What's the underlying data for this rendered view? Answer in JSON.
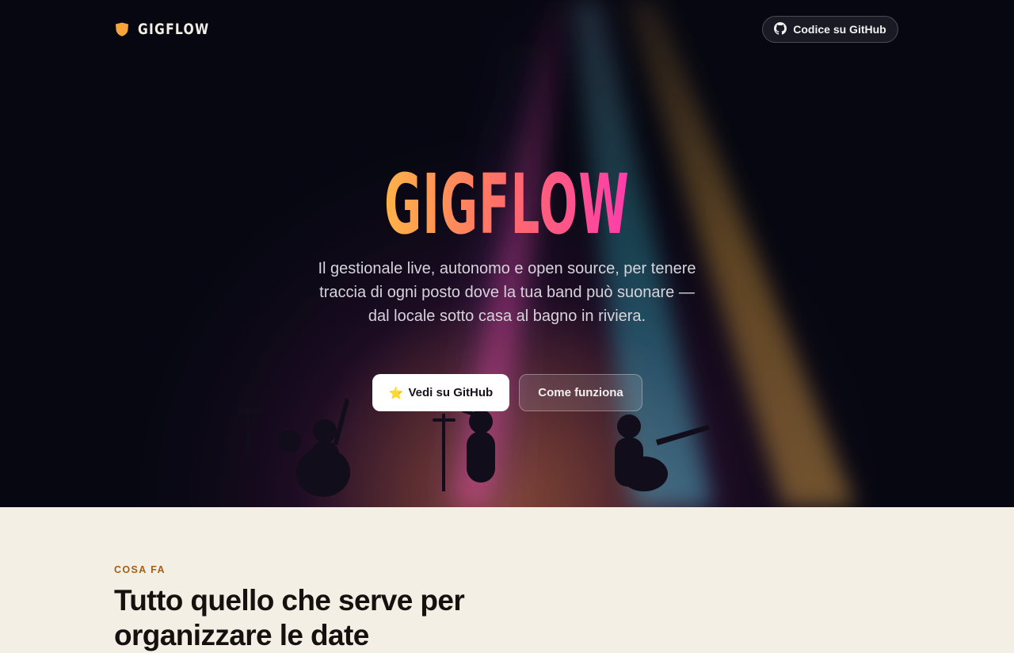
{
  "nav": {
    "logo_text": "GIGFLOW",
    "github_label": "Codice su GitHub"
  },
  "hero": {
    "title": "GIGFLOW",
    "subtitle": "Il gestionale live, autonomo e open source, per tenere traccia di ogni posto dove la tua band può suonare — dal locale sotto casa al bagno in riviera.",
    "primary_cta_icon": "⭐",
    "primary_cta_label": "Vedi su GitHub",
    "secondary_cta_label": "Come funziona"
  },
  "section": {
    "kicker": "COSA FA",
    "heading": "Tutto quello che serve per organizzare le date"
  },
  "colors": {
    "hero_bg": "#070812",
    "title_gradient": [
      "#ffb347",
      "#ff6b6b",
      "#ff3cac"
    ],
    "shield": "#f7a43c",
    "section_bg": "#f4efe4",
    "kicker": "#a35f14"
  },
  "icons": {
    "logo": "shield-icon",
    "github": "github-icon",
    "star": "star-icon"
  }
}
